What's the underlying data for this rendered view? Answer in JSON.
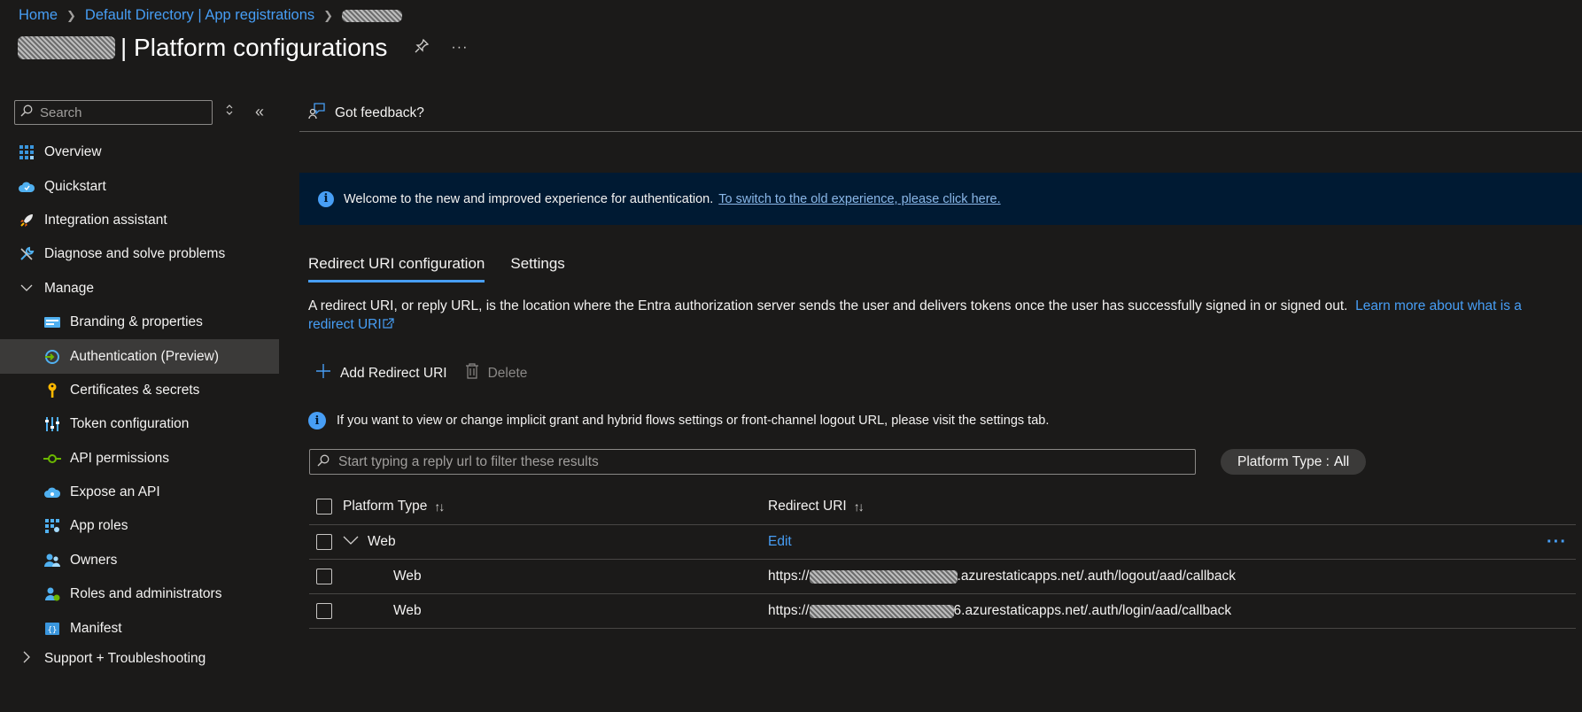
{
  "breadcrumb": {
    "home": "Home",
    "directory": "Default Directory | App registrations"
  },
  "page": {
    "title": "| Platform configurations"
  },
  "sidebar": {
    "search_placeholder": "Search",
    "items": [
      {
        "label": "Overview",
        "icon": "grid-icon"
      },
      {
        "label": "Quickstart",
        "icon": "cloud-icon"
      },
      {
        "label": "Integration assistant",
        "icon": "rocket-icon"
      },
      {
        "label": "Diagnose and solve problems",
        "icon": "wrench-icon"
      },
      {
        "label": "Manage",
        "icon": "chevron-down-icon"
      },
      {
        "label": "Branding & properties",
        "icon": "card-icon"
      },
      {
        "label": "Authentication (Preview)",
        "icon": "auth-icon"
      },
      {
        "label": "Certificates & secrets",
        "icon": "key-icon"
      },
      {
        "label": "Token configuration",
        "icon": "sliders-icon"
      },
      {
        "label": "API permissions",
        "icon": "permission-icon"
      },
      {
        "label": "Expose an API",
        "icon": "cloud-api-icon"
      },
      {
        "label": "App roles",
        "icon": "roles-grid-icon"
      },
      {
        "label": "Owners",
        "icon": "people-icon"
      },
      {
        "label": "Roles and administrators",
        "icon": "admin-icon"
      },
      {
        "label": "Manifest",
        "icon": "manifest-icon"
      },
      {
        "label": "Support + Troubleshooting",
        "icon": "chevron-right-icon"
      }
    ]
  },
  "feedback": "Got feedback?",
  "banner": {
    "text": "Welcome to the new and improved experience for authentication.",
    "link": "To switch to the old experience, please click here."
  },
  "tabs": [
    "Redirect URI configuration",
    "Settings"
  ],
  "description": {
    "text": "A redirect URI, or reply URL, is the location where the Entra authorization server sends the user and delivers tokens once the user has successfully signed in or signed out.",
    "link": "Learn more about what is a redirect URI"
  },
  "toolbar": {
    "add": "Add Redirect URI",
    "delete": "Delete"
  },
  "note": "If you want to view or change implicit grant and hybrid flows settings or front-channel logout URL, please visit the settings tab.",
  "filter": {
    "placeholder": "Start typing a reply url to filter these results",
    "pill_label": "Platform Type :",
    "pill_value": "All"
  },
  "table": {
    "col_platform": "Platform Type",
    "col_uri": "Redirect URI",
    "group": {
      "platform": "Web",
      "action": "Edit"
    },
    "rows": [
      {
        "platform": "Web",
        "uri_prefix": "https://",
        "uri_suffix": ".azurestaticapps.net/.auth/logout/aad/callback"
      },
      {
        "platform": "Web",
        "uri_prefix": "https://",
        "uri_suffix": "6.azurestaticapps.net/.auth/login/aad/callback"
      }
    ]
  }
}
